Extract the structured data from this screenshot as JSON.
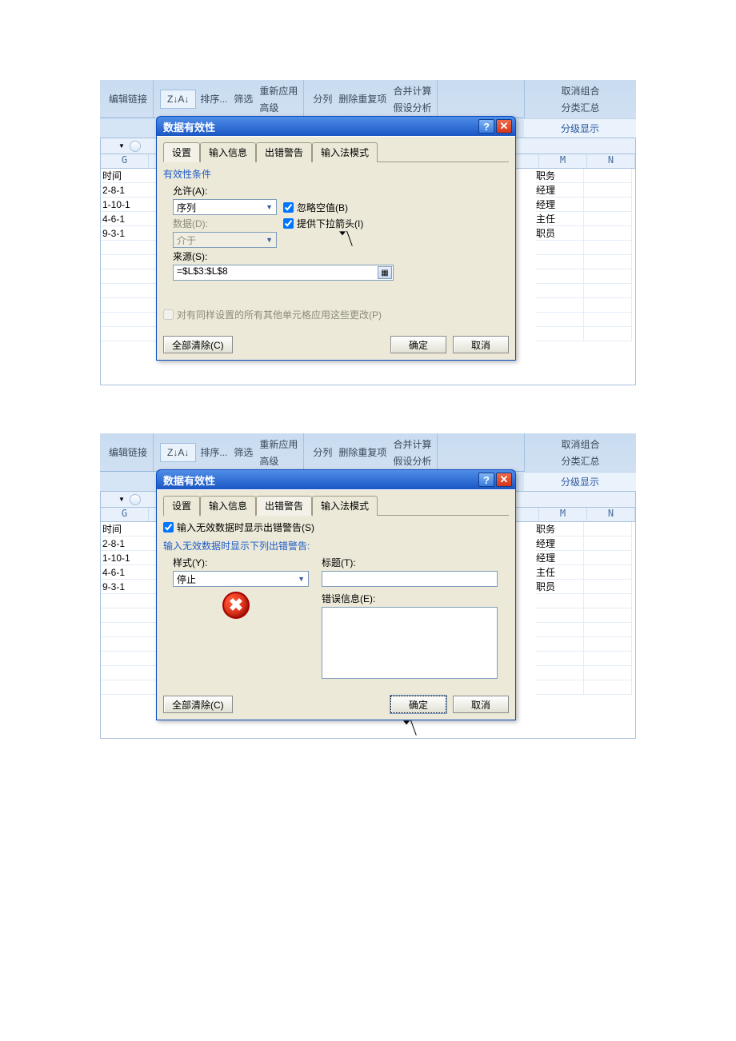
{
  "ribbon": {
    "edit_links": "编辑链接",
    "sort_icon": "Z↓A↓",
    "sort": "排序...",
    "filter": "筛选",
    "reapply": "重新应用",
    "advanced": "高级",
    "text_to_cols": "分列",
    "remove_dup": "删除重复项",
    "calc": "合并计算",
    "whatif": "假设分析",
    "ungroup": "取消组合",
    "subtotal": "分类汇总",
    "outline_label": "分级显示"
  },
  "cols": {
    "g": "G",
    "m": "M",
    "n": "N"
  },
  "sheet": {
    "left_header": "时间",
    "left_rows": [
      "2-8-1",
      "1-10-1",
      "4-6-1",
      "9-3-1"
    ],
    "right_header": "职务",
    "right_rows": [
      "经理",
      "经理",
      "主任",
      "职员"
    ]
  },
  "dialog": {
    "title": "数据有效性",
    "tabs": {
      "settings": "设置",
      "input_msg": "输入信息",
      "error_alert": "出错警告",
      "ime": "输入法模式"
    },
    "settings": {
      "group_label": "有效性条件",
      "allow_label": "允许(A):",
      "allow_value": "序列",
      "data_label": "数据(D):",
      "data_value": "介于",
      "ignore_blank": "忽略空值(B)",
      "dropdown": "提供下拉箭头(I)",
      "source_label": "来源(S):",
      "source_value": "=$L$3:$L$8",
      "apply_others": "对有同样设置的所有其他单元格应用这些更改(P)"
    },
    "error": {
      "show_alert": "输入无效数据时显示出错警告(S)",
      "group_label": "输入无效数据时显示下列出错警告:",
      "style_label": "样式(Y):",
      "style_value": "停止",
      "title_label": "标题(T):",
      "title_value": "",
      "msg_label": "错误信息(E):",
      "msg_value": ""
    },
    "buttons": {
      "clear_all": "全部清除(C)",
      "ok": "确定",
      "cancel": "取消"
    }
  }
}
